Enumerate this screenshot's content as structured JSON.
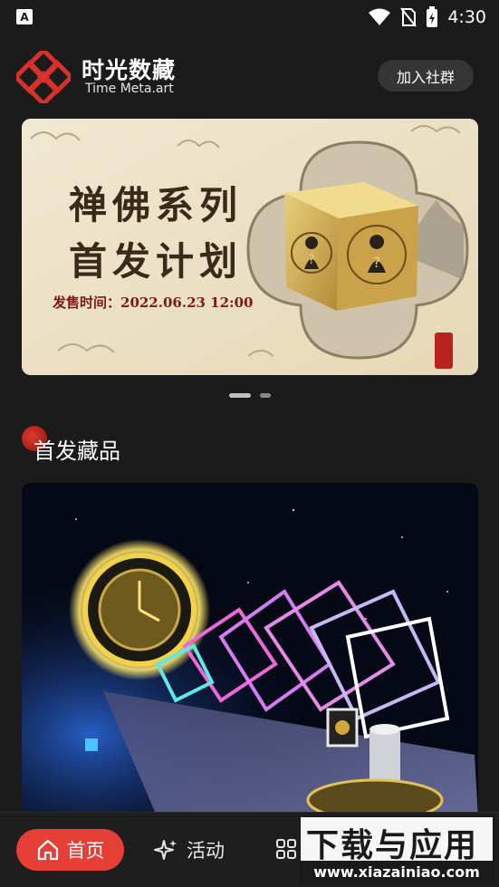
{
  "status_bar": {
    "time": "4:30",
    "app_icon_letter": "A"
  },
  "header": {
    "brand_name": "时光数藏",
    "brand_subtitle": "Time Meta.art",
    "join_button": "加入社群"
  },
  "banner": {
    "title_line1": "禅佛系列",
    "title_line2": "首发计划",
    "release_label": "发售时间：2022.06.23  12:00",
    "pager": {
      "count": 2,
      "active_index": 0
    }
  },
  "section": {
    "title": "首发藏品"
  },
  "bottom_nav": {
    "items": [
      {
        "label": "首页",
        "icon": "home-icon",
        "active": true
      },
      {
        "label": "活动",
        "icon": "sparkle-icon",
        "active": false
      },
      {
        "label": "",
        "icon": "grid-icon",
        "active": false
      }
    ],
    "accent": "#e53f36"
  },
  "watermark": {
    "main": "下载与应用",
    "sub": "www.xiazainiao.com"
  }
}
